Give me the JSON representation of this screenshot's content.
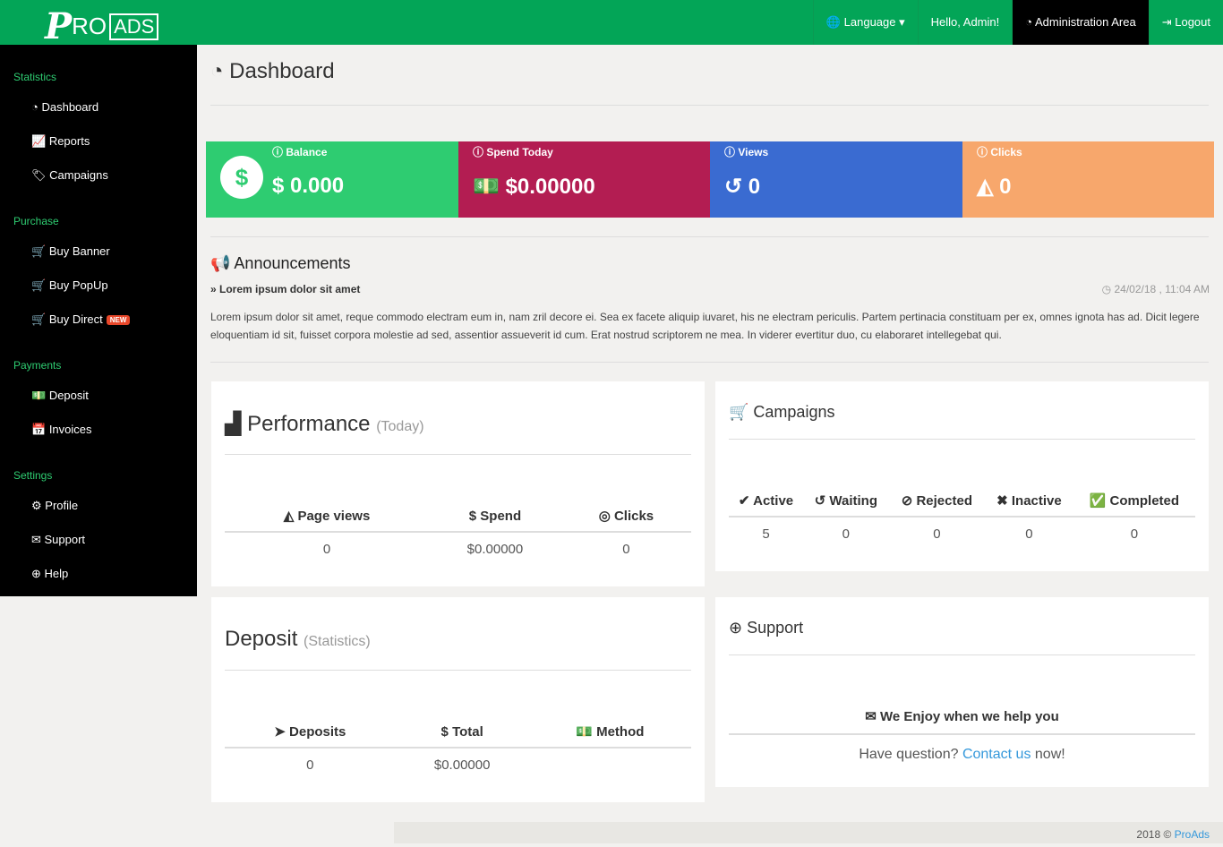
{
  "header": {
    "logo_p": "P",
    "logo_ro": "RO",
    "logo_ads": "ADS",
    "language": "Language",
    "hello": "Hello, Admin!",
    "admin_area": "Administration Area",
    "logout": "Logout"
  },
  "sidebar": {
    "sections": [
      {
        "title": "Statistics",
        "items": [
          "Dashboard",
          "Reports",
          "Campaigns"
        ]
      },
      {
        "title": "Purchase",
        "items": [
          "Buy Banner",
          "Buy PopUp",
          "Buy Direct"
        ]
      },
      {
        "title": "Payments",
        "items": [
          "Deposit",
          "Invoices"
        ]
      },
      {
        "title": "Settings",
        "items": [
          "Profile",
          "Support",
          "Help"
        ]
      }
    ],
    "new_badge": "NEW"
  },
  "page_title": "Dashboard",
  "stats": [
    {
      "label": "Balance",
      "value": "$ 0.000",
      "color": "#2ecc71"
    },
    {
      "label": "Spend Today",
      "value": "$0.00000",
      "color": "#b31d52"
    },
    {
      "label": "Views",
      "value": "0",
      "color": "#3a6bd1"
    },
    {
      "label": "Clicks",
      "value": "0",
      "color": "#f7a76c"
    }
  ],
  "announcements": {
    "heading": "Announcements",
    "title": "Lorem ipsum dolor sit amet",
    "date": "24/02/18 , 11:04 AM",
    "body": "Lorem ipsum dolor sit amet, reque commodo electram eum in, nam zril decore ei. Sea ex facete aliquip iuvaret, his ne electram periculis. Partem pertinacia constituam per ex, omnes ignota has ad. Dicit legere eloquentiam id sit, fuisset corpora molestie ad sed, assentior assueverit id cum. Erat nostrud scriptorem ne mea. In viderer evertitur duo, cu elaboraret intellegebat qui."
  },
  "performance": {
    "title": "Performance",
    "sub": "(Today)",
    "headers": [
      "Page views",
      "Spend",
      "Clicks"
    ],
    "row": [
      "0",
      "$0.00000",
      "0"
    ]
  },
  "campaigns": {
    "title": "Campaigns",
    "headers": [
      "Active",
      "Waiting",
      "Rejected",
      "Inactive",
      "Completed"
    ],
    "row": [
      "5",
      "0",
      "0",
      "0",
      "0"
    ]
  },
  "deposit": {
    "title": "Deposit",
    "sub": "(Statistics)",
    "headers": [
      "Deposits",
      "Total",
      "Method"
    ],
    "row": [
      "0",
      "$0.00000",
      ""
    ]
  },
  "support": {
    "title": "Support",
    "heading": "We Enjoy when we help you",
    "pre": "Have question?",
    "link": "Contact us",
    "post": "now!"
  },
  "footer": {
    "text": "2018 ©",
    "link": "ProAds"
  }
}
